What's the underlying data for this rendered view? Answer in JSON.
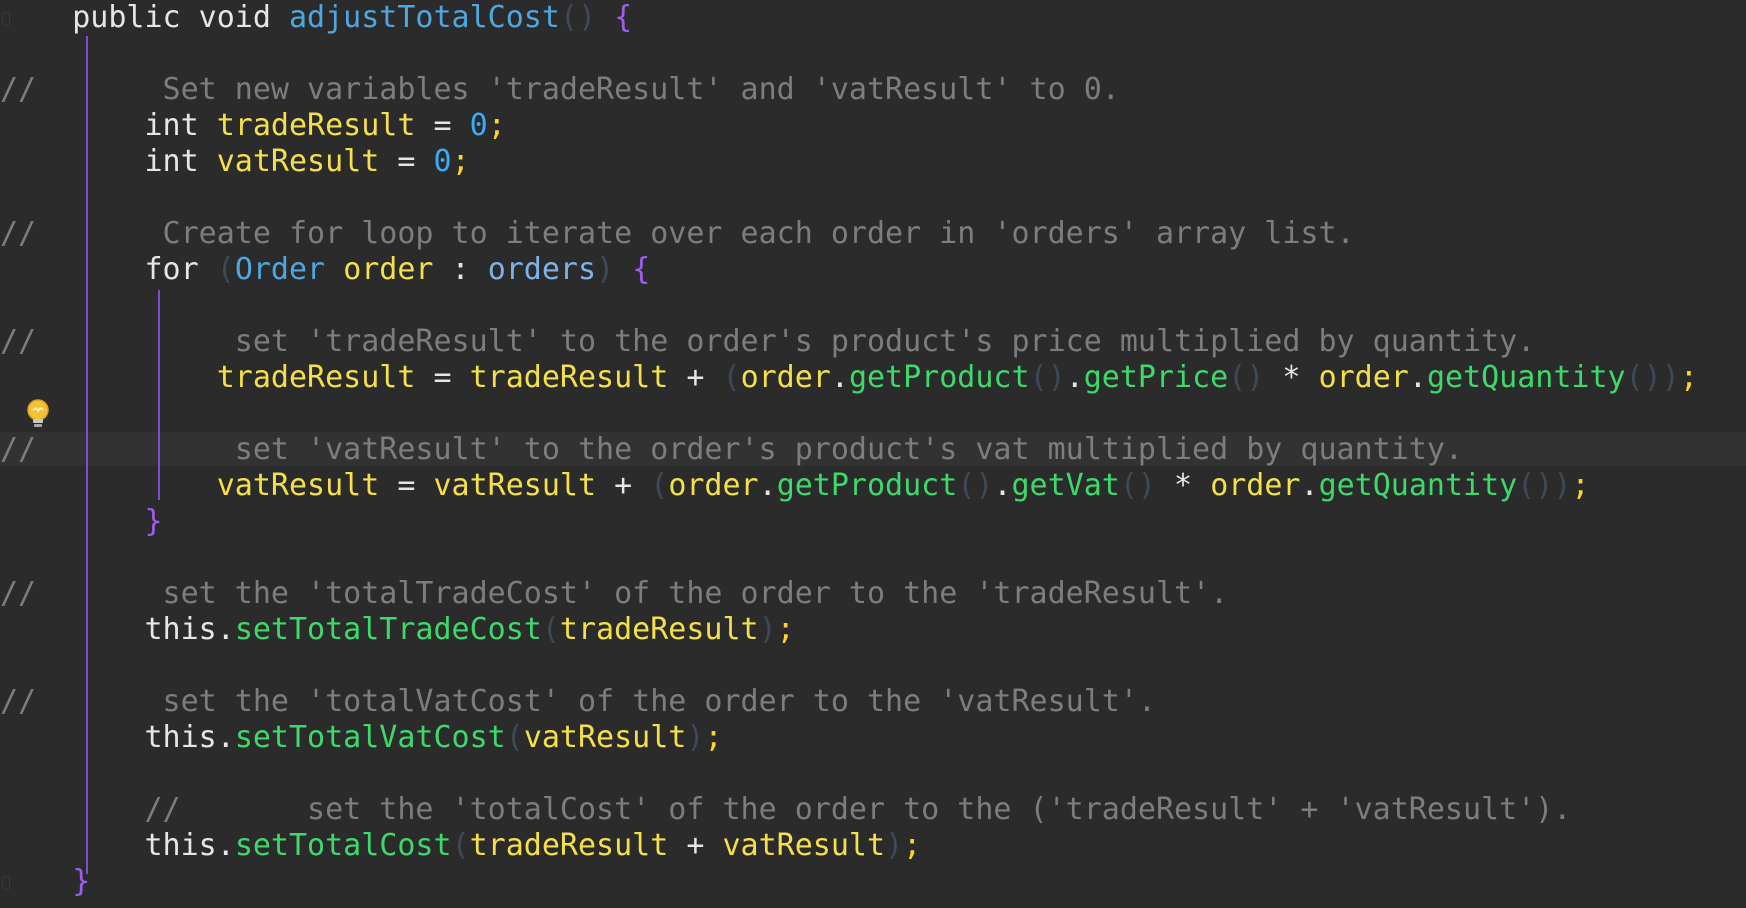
{
  "editor": {
    "lines": [
      [
        {
          "t": "    "
        },
        {
          "t": "public void ",
          "c": "kw"
        },
        {
          "t": "adjustTotalCost",
          "c": "fn"
        },
        {
          "t": "()",
          "c": "pr"
        },
        {
          "t": " "
        },
        {
          "t": "{",
          "c": "br"
        }
      ],
      [],
      [
        {
          "t": "//       Set new variables 'tradeResult' and 'vatResult' to 0.",
          "c": "cm"
        }
      ],
      [
        {
          "t": "        "
        },
        {
          "t": "int ",
          "c": "kw"
        },
        {
          "t": "tradeResult",
          "c": "var"
        },
        {
          "t": " = ",
          "c": "op"
        },
        {
          "t": "0",
          "c": "num"
        },
        {
          "t": ";",
          "c": "sc"
        }
      ],
      [
        {
          "t": "        "
        },
        {
          "t": "int ",
          "c": "kw"
        },
        {
          "t": "vatResult",
          "c": "var"
        },
        {
          "t": " = ",
          "c": "op"
        },
        {
          "t": "0",
          "c": "num"
        },
        {
          "t": ";",
          "c": "sc"
        }
      ],
      [],
      [
        {
          "t": "//       Create for loop to iterate over each order in 'orders' array list.",
          "c": "cm"
        }
      ],
      [
        {
          "t": "        "
        },
        {
          "t": "for ",
          "c": "kw"
        },
        {
          "t": "(",
          "c": "pr"
        },
        {
          "t": "Order ",
          "c": "typ"
        },
        {
          "t": "order",
          "c": "var"
        },
        {
          "t": " : ",
          "c": "op"
        },
        {
          "t": "orders",
          "c": "fld"
        },
        {
          "t": ")",
          "c": "pr"
        },
        {
          "t": " "
        },
        {
          "t": "{",
          "c": "br"
        }
      ],
      [],
      [
        {
          "t": "//           set 'tradeResult' to the order's product's price multiplied by quantity.",
          "c": "cm"
        }
      ],
      [
        {
          "t": "            "
        },
        {
          "t": "tradeResult",
          "c": "var"
        },
        {
          "t": " = ",
          "c": "op"
        },
        {
          "t": "tradeResult",
          "c": "var"
        },
        {
          "t": " + ",
          "c": "op"
        },
        {
          "t": "(",
          "c": "pr"
        },
        {
          "t": "order",
          "c": "var"
        },
        {
          "t": ".",
          "c": "op"
        },
        {
          "t": "getProduct",
          "c": "mth"
        },
        {
          "t": "()",
          "c": "pr"
        },
        {
          "t": ".",
          "c": "op"
        },
        {
          "t": "getPrice",
          "c": "mth"
        },
        {
          "t": "()",
          "c": "pr"
        },
        {
          "t": " * ",
          "c": "op"
        },
        {
          "t": "order",
          "c": "var"
        },
        {
          "t": ".",
          "c": "op"
        },
        {
          "t": "getQuantity",
          "c": "mth"
        },
        {
          "t": "())",
          "c": "pr"
        },
        {
          "t": ";",
          "c": "sc"
        }
      ],
      [],
      [
        {
          "t": "//           set 'vatResult' to the order's product's vat multiplied by quantity.",
          "c": "cm"
        }
      ],
      [
        {
          "t": "            "
        },
        {
          "t": "vatResult",
          "c": "var"
        },
        {
          "t": " = ",
          "c": "op"
        },
        {
          "t": "vatResult",
          "c": "var"
        },
        {
          "t": " + ",
          "c": "op"
        },
        {
          "t": "(",
          "c": "pr"
        },
        {
          "t": "order",
          "c": "var"
        },
        {
          "t": ".",
          "c": "op"
        },
        {
          "t": "getProduct",
          "c": "mth"
        },
        {
          "t": "()",
          "c": "pr"
        },
        {
          "t": ".",
          "c": "op"
        },
        {
          "t": "getVat",
          "c": "mth"
        },
        {
          "t": "()",
          "c": "pr"
        },
        {
          "t": " * ",
          "c": "op"
        },
        {
          "t": "order",
          "c": "var"
        },
        {
          "t": ".",
          "c": "op"
        },
        {
          "t": "getQuantity",
          "c": "mth"
        },
        {
          "t": "())",
          "c": "pr"
        },
        {
          "t": ";",
          "c": "sc"
        }
      ],
      [
        {
          "t": "        "
        },
        {
          "t": "}",
          "c": "br"
        }
      ],
      [],
      [
        {
          "t": "//       set the 'totalTradeCost' of the order to the 'tradeResult'.",
          "c": "cm"
        }
      ],
      [
        {
          "t": "        "
        },
        {
          "t": "this",
          "c": "kw"
        },
        {
          "t": ".",
          "c": "op"
        },
        {
          "t": "setTotalTradeCost",
          "c": "mth"
        },
        {
          "t": "(",
          "c": "pr"
        },
        {
          "t": "tradeResult",
          "c": "var"
        },
        {
          "t": ")",
          "c": "pr"
        },
        {
          "t": ";",
          "c": "sc"
        }
      ],
      [],
      [
        {
          "t": "//       set the 'totalVatCost' of the order to the 'vatResult'.",
          "c": "cm"
        }
      ],
      [
        {
          "t": "        "
        },
        {
          "t": "this",
          "c": "kw"
        },
        {
          "t": ".",
          "c": "op"
        },
        {
          "t": "setTotalVatCost",
          "c": "mth"
        },
        {
          "t": "(",
          "c": "pr"
        },
        {
          "t": "vatResult",
          "c": "var"
        },
        {
          "t": ")",
          "c": "pr"
        },
        {
          "t": ";",
          "c": "sc"
        }
      ],
      [],
      [
        {
          "t": "        //       set the 'totalCost' of the order to the ('tradeResult' + 'vatResult').",
          "c": "cm"
        }
      ],
      [
        {
          "t": "        "
        },
        {
          "t": "this",
          "c": "kw"
        },
        {
          "t": ".",
          "c": "op"
        },
        {
          "t": "setTotalCost",
          "c": "mth"
        },
        {
          "t": "(",
          "c": "pr"
        },
        {
          "t": "tradeResult",
          "c": "var"
        },
        {
          "t": " + ",
          "c": "op"
        },
        {
          "t": "vatResult",
          "c": "var"
        },
        {
          "t": ")",
          "c": "pr"
        },
        {
          "t": ";",
          "c": "sc"
        }
      ],
      [
        {
          "t": "    "
        },
        {
          "t": "}",
          "c": "br"
        }
      ]
    ],
    "icons": {
      "intention": "lightbulb-icon"
    },
    "colors": {
      "background": "#2b2b2b",
      "current_line": "#323232",
      "comment": "#7d7d7d",
      "keyword": "#e6e6e6",
      "method_name": "#4fa7e0",
      "brace": "#9f5cf0",
      "variable": "#f4e04a",
      "number": "#3fa9f5",
      "method_call": "#3ed96b",
      "indent_guide": "#7a4fd0"
    }
  }
}
